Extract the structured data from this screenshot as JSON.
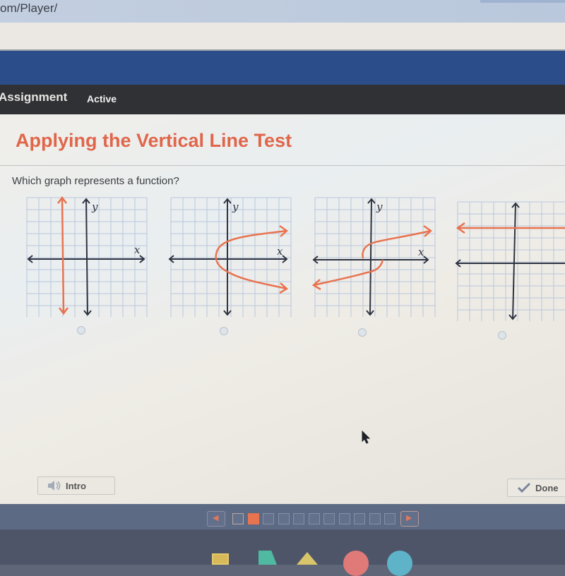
{
  "browser": {
    "url_fragment": "om/Player/"
  },
  "nav": {
    "section": "Assignment",
    "status": "Active"
  },
  "lesson": {
    "title": "Applying the Vertical Line Test",
    "question": "Which graph represents a function?"
  },
  "colors": {
    "accent": "#e0664a",
    "curve": "#e8734f",
    "axis": "#2e3340",
    "grid": "#b8c7dc",
    "brand_bar": "#2b4d8a",
    "nav_bar": "#2f3135"
  },
  "graphs": [
    {
      "id": "A",
      "x_label": "x",
      "y_label": "y",
      "curve": "vertical line x = -2",
      "selected": false
    },
    {
      "id": "B",
      "x_label": "x",
      "y_label": "y",
      "curve": "sideways parabola opening right, vertex near (-1, 0)",
      "selected": false
    },
    {
      "id": "C",
      "x_label": "x",
      "y_label": "y",
      "curve": "sideways S-shaped curve",
      "selected": false
    },
    {
      "id": "D",
      "x_label": "",
      "y_label": "",
      "curve": "horizontal line y = 3",
      "selected": false
    }
  ],
  "buttons": {
    "intro": "Intro",
    "done": "Done"
  },
  "pager": {
    "total": 11,
    "current": 2,
    "visited": [
      1
    ],
    "prev_icon": "◀",
    "next_icon": "▶"
  },
  "icons": {
    "speaker": "speaker-icon",
    "check": "checkmark-icon"
  }
}
